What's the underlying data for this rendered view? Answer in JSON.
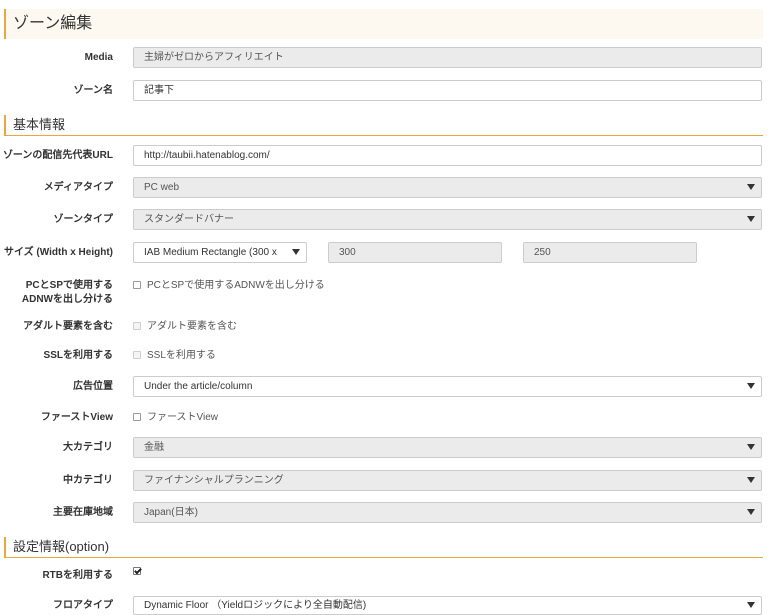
{
  "theme": {
    "accent": "#e8a73f",
    "header_bg": "#fdf9f1",
    "disabled_bg": "#ebebeb",
    "border": "#cccccc"
  },
  "icons": {
    "select_arrow": "chevron-down-icon",
    "checkbox_check": "check-icon"
  },
  "header": {
    "title": "ゾーン編集"
  },
  "media": {
    "label": "Media",
    "value": "主婦がゼロからアフィリエイト",
    "disabled": true
  },
  "zone_name": {
    "label": "ゾーン名",
    "value": "記事下",
    "disabled": false
  },
  "section_basic": {
    "title": "基本情報"
  },
  "url": {
    "label": "ゾーンの配信先代表URL",
    "value": "http://taubii.hatenablog.com/",
    "disabled": false
  },
  "media_type": {
    "label": "メディアタイプ",
    "selected": "PC web",
    "disabled": true
  },
  "zone_type": {
    "label": "ゾーンタイプ",
    "selected": "スタンダードバナー",
    "disabled": true
  },
  "size": {
    "label": "サイズ (Width x Height)",
    "preset_selected": "IAB Medium Rectangle (300 x",
    "width": "300",
    "height": "250",
    "width_disabled": true,
    "height_disabled": true
  },
  "pc_sp_split": {
    "label_lines": [
      "PCとSPで使用する",
      "ADNWを出し分ける"
    ],
    "option_text": "PCとSPで使用するADNWを出し分ける",
    "checked": false,
    "disabled": false
  },
  "adult": {
    "label": "アダルト要素を含む",
    "option_text": "アダルト要素を含む",
    "checked": false,
    "disabled": true
  },
  "ssl": {
    "label": "SSLを利用する",
    "option_text": "SSLを利用する",
    "checked": false,
    "disabled": true
  },
  "ad_position": {
    "label": "広告位置",
    "selected": "Under the article/column",
    "disabled": false
  },
  "first_view": {
    "label": "ファーストView",
    "option_text": "ファーストView",
    "checked": false,
    "disabled": false
  },
  "category_large": {
    "label": "大カテゴリ",
    "selected": "金融",
    "disabled": true
  },
  "category_mid": {
    "label": "中カテゴリ",
    "selected": "ファイナンシャルプランニング",
    "disabled": true
  },
  "region": {
    "label": "主要在庫地域",
    "selected": "Japan(日本)",
    "disabled": true
  },
  "section_settings": {
    "title": "設定情報(option)"
  },
  "rtb": {
    "label": "RTBを利用する",
    "checked": true,
    "disabled": false
  },
  "floor_type": {
    "label": "フロアタイプ",
    "selected": "Dynamic Floor （Yieldロジックにより全自動配信)",
    "disabled": false
  }
}
